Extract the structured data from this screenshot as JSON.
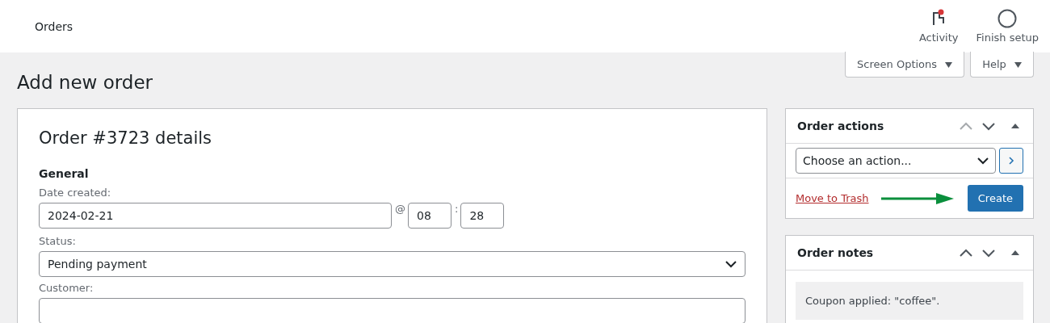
{
  "header": {
    "title": "Orders",
    "actions": [
      {
        "kind": "activity",
        "label": "Activity",
        "unread": true
      },
      {
        "kind": "setup",
        "label": "Finish setup"
      }
    ]
  },
  "screen_tabs": [
    {
      "label": "Screen Options"
    },
    {
      "label": "Help"
    }
  ],
  "page_title": "Add new order",
  "order": {
    "heading": "Order #3723 details",
    "section": "General",
    "date_label": "Date created:",
    "date": "2024-02-21",
    "at": "@",
    "hour": "08",
    "colon": ":",
    "minute": "28",
    "status_label": "Status:",
    "status": "Pending payment",
    "customer_label": "Customer:"
  },
  "order_actions": {
    "title": "Order actions",
    "select": "Choose an action...",
    "trash": "Move to Trash",
    "create": "Create"
  },
  "order_notes": {
    "title": "Order notes",
    "notes": [
      {
        "text": "Coupon applied: \"coffee\"."
      }
    ]
  }
}
